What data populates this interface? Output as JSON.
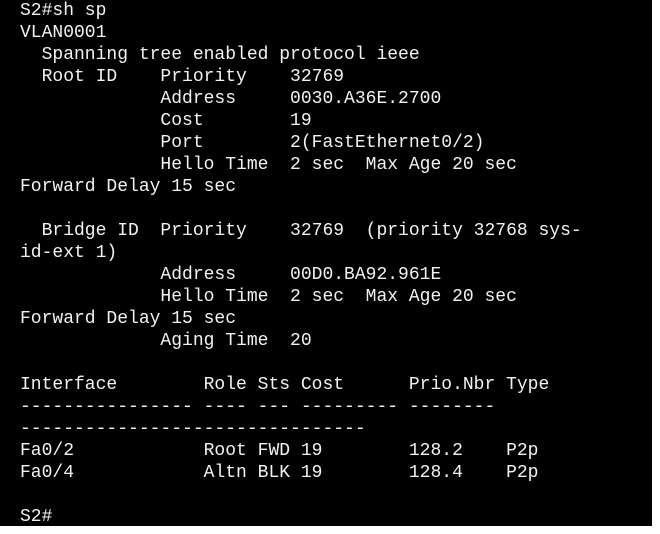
{
  "terminal": {
    "lines": [
      "S2#sh sp",
      "VLAN0001",
      "  Spanning tree enabled protocol ieee",
      "  Root ID    Priority    32769",
      "             Address     0030.A36E.2700",
      "             Cost        19",
      "             Port        2(FastEthernet0/2)",
      "             Hello Time  2 sec  Max Age 20 sec",
      "Forward Delay 15 sec",
      "",
      "  Bridge ID  Priority    32769  (priority 32768 sys-",
      "id-ext 1)",
      "             Address     00D0.BA92.961E",
      "             Hello Time  2 sec  Max Age 20 sec",
      "Forward Delay 15 sec",
      "             Aging Time  20",
      "",
      "Interface        Role Sts Cost      Prio.Nbr Type",
      "---------------- ---- --- --------- --------",
      "--------------------------------",
      "Fa0/2            Root FWD 19        128.2    P2p",
      "Fa0/4            Altn BLK 19        128.4    P2p",
      "",
      "S2#"
    ]
  }
}
